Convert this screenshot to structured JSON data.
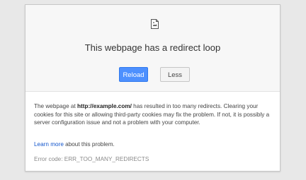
{
  "error": {
    "title": "This webpage has a redirect loop",
    "buttons": {
      "reload_label": "Reload",
      "less_label": "Less"
    },
    "details": {
      "prefix": "The webpage at ",
      "url": "http://example.com/",
      "suffix": " has resulted in too many redirects. Clearing your cookies for this site or allowing third-party cookies may fix the problem. If not, it is possibly a server configuration issue and not a problem with your computer."
    },
    "learn_more": {
      "link_text": "Learn more",
      "rest": " about this problem."
    },
    "error_code": "Error code: ERR_TOO_MANY_REDIRECTS"
  },
  "icons": {
    "page": "broken-page-icon"
  }
}
